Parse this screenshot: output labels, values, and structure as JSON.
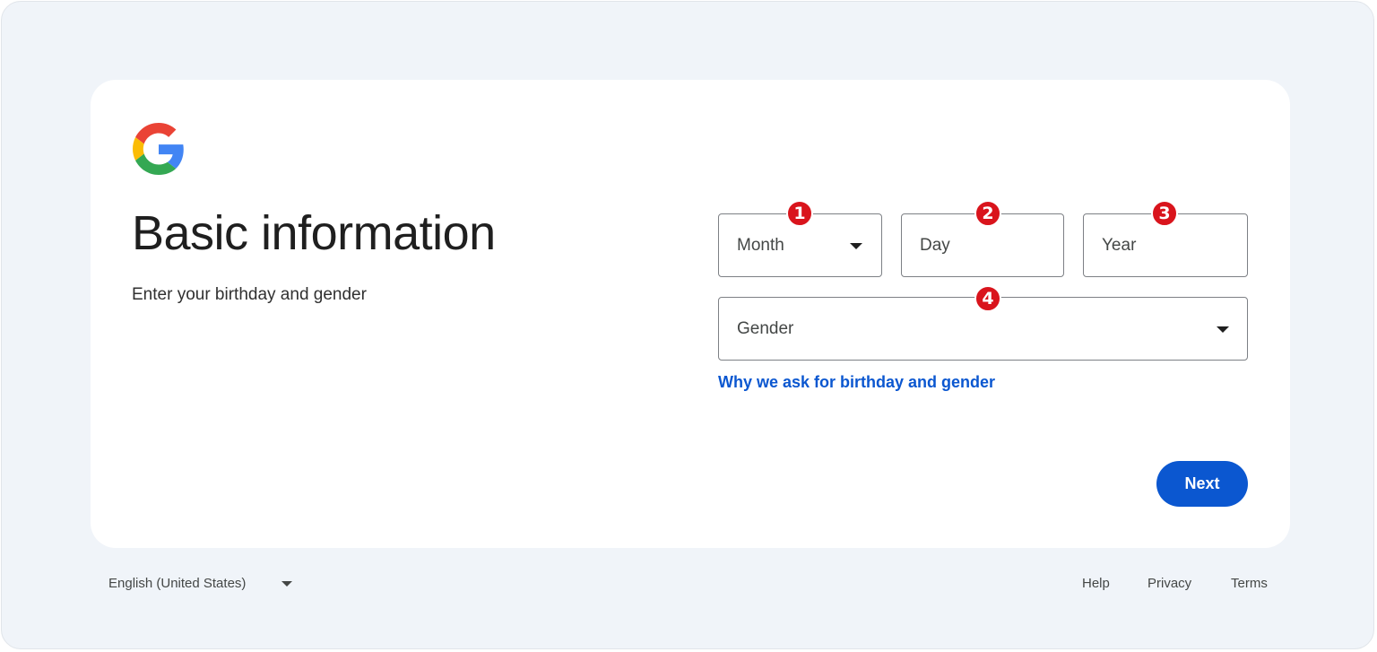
{
  "page": {
    "title": "Basic information",
    "subtitle": "Enter your birthday and gender"
  },
  "form": {
    "month": {
      "placeholder": "Month",
      "badge": "1"
    },
    "day": {
      "placeholder": "Day",
      "badge": "2"
    },
    "year": {
      "placeholder": "Year",
      "badge": "3"
    },
    "gender": {
      "placeholder": "Gender",
      "badge": "4"
    },
    "why_link": "Why we ask for birthday and gender",
    "next_label": "Next"
  },
  "footer": {
    "language": "English (United States)",
    "links": [
      "Help",
      "Privacy",
      "Terms"
    ]
  },
  "colors": {
    "background": "#f0f4f9",
    "primary": "#0b57d0",
    "badge": "#d9141c"
  },
  "icons": {
    "logo": "google-logo-icon",
    "dropdown": "caret-down-icon"
  }
}
